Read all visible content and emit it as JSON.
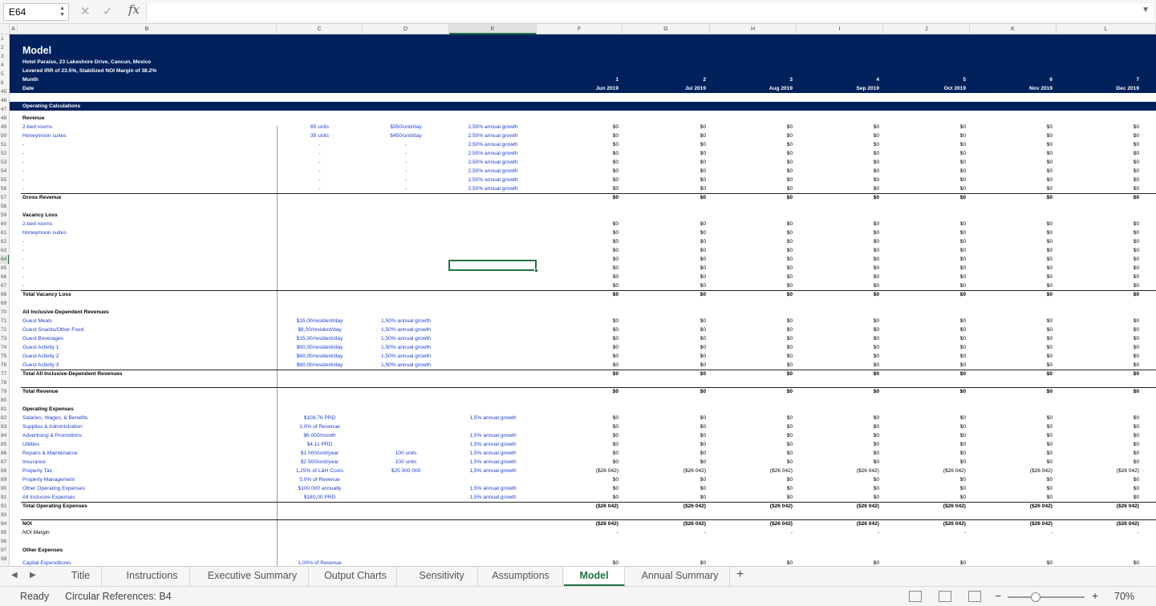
{
  "app": {
    "name_box": "E64",
    "fx": "fx",
    "formula": ""
  },
  "columns": [
    "A",
    "B",
    "C",
    "D",
    "E",
    "F",
    "G",
    "H",
    "I",
    "J",
    "K",
    "L"
  ],
  "header": {
    "title": "Model",
    "address": "Hotel Paraíso, 23 Lakeshore Drive, Cancun, Mexico",
    "summary": "Levered IRR of 23.5%, Stabilized NOI Margin of 38.2%",
    "row5": "Month",
    "row6": "Date",
    "months": [
      "1",
      "2",
      "3",
      "4",
      "5",
      "6",
      "7"
    ],
    "dates": [
      "Jun 2019",
      "Jul 2019",
      "Aug 2019",
      "Sep 2019",
      "Oct 2019",
      "Nov 2019",
      "Dec 2019"
    ]
  },
  "row_numbers": [
    "1",
    "2",
    "3",
    "4",
    "5",
    "6",
    "45",
    "46",
    "47",
    "48",
    "49",
    "50",
    "51",
    "52",
    "53",
    "54",
    "55",
    "56",
    "57",
    "58",
    "59",
    "60",
    "61",
    "62",
    "63",
    "64",
    "65",
    "66",
    "67",
    "68",
    "69",
    "70",
    "71",
    "72",
    "73",
    "74",
    "75",
    "76",
    "77",
    "78",
    "79",
    "80",
    "81",
    "82",
    "83",
    "84",
    "85",
    "86",
    "87",
    "88",
    "89",
    "90",
    "91",
    "92",
    "93",
    "94",
    "95",
    "96",
    "97",
    "98"
  ],
  "section": "Operating Calculations",
  "revenue": {
    "heading": "Revenue",
    "rows": [
      {
        "label": "2-bed rooms",
        "c": "65 units",
        "d": "$350/unit/day",
        "e": "2,50% annual growth"
      },
      {
        "label": "Honeymoon suites",
        "c": "35 units",
        "d": "$450/unit/day",
        "e": "2,50% annual growth"
      },
      {
        "label": "-",
        "c": "-",
        "d": "-",
        "e": "2,50% annual growth"
      },
      {
        "label": "-",
        "c": "-",
        "d": "-",
        "e": "2,50% annual growth"
      },
      {
        "label": "-",
        "c": "-",
        "d": "-",
        "e": "2,50% annual growth"
      },
      {
        "label": "-",
        "c": "-",
        "d": "-",
        "e": "2,50% annual growth"
      },
      {
        "label": "-",
        "c": "-",
        "d": "-",
        "e": "2,50% annual growth"
      },
      {
        "label": "-",
        "c": "-",
        "d": "-",
        "e": "2,50% annual growth"
      }
    ],
    "total": "Gross Revenue"
  },
  "vacancy": {
    "heading": "Vacancy Loss",
    "rows": [
      "2-bed rooms",
      "Honeymoon suites",
      "-",
      "-",
      "-",
      "-",
      "-",
      "-"
    ],
    "total": "Total Vacancy Loss"
  },
  "inclusive": {
    "heading": "All Inclusive-Dependent Revenues",
    "rows": [
      {
        "label": "Guest Meals",
        "c": "$15,00/resident/day",
        "d": "1,50% annual growth"
      },
      {
        "label": "Guest Snacks/Other Food",
        "c": "$6,00/resident/day",
        "d": "1,50% annual growth"
      },
      {
        "label": "Guest Beverages",
        "c": "$15,00/resident/day",
        "d": "1,50% annual growth"
      },
      {
        "label": "Guest Activity 1",
        "c": "$60,00/resident/day",
        "d": "1,50% annual growth"
      },
      {
        "label": "Guest Activity 2",
        "c": "$60,00/resident/day",
        "d": "1,50% annual growth"
      },
      {
        "label": "Guest Activity 3",
        "c": "$60,00/resident/day",
        "d": "1,50% annual growth"
      }
    ],
    "total": "Total All Inclusive-Dependent Revenues"
  },
  "total_revenue": "Total Revenue",
  "opex": {
    "heading": "Operating Expenses",
    "rows": [
      {
        "label": "Salaries, Wages, & Benefits",
        "c": "$108,76 PRD",
        "d": "",
        "e": "1,5% annual growth",
        "v": "$0"
      },
      {
        "label": "Supplies & Administration",
        "c": "2,0% of Revenue",
        "d": "",
        "e": "",
        "v": "$0"
      },
      {
        "label": "Advertising & Promotions",
        "c": "$6 000/month",
        "d": "",
        "e": "1,5% annual growth",
        "v": "$0"
      },
      {
        "label": "Utilities",
        "c": "$4,11 PRD",
        "d": "",
        "e": "1,5% annual growth",
        "v": "$0"
      },
      {
        "label": "Repairs & Maintenance",
        "c": "$1 000/unit/year",
        "d": "100 units",
        "e": "1,5% annual growth",
        "v": "$0"
      },
      {
        "label": "Insurance",
        "c": "$2 500/unit/year",
        "d": "100 units",
        "e": "1,5% annual growth",
        "v": "$0"
      },
      {
        "label": "Property Tax",
        "c": "1,25% of L&H Costs",
        "d": "$25 000 000",
        "e": "1,5% annual growth",
        "v": "($26 042)"
      },
      {
        "label": "Property Management",
        "c": "5,0% of Revenue",
        "d": "",
        "e": "",
        "v": "$0"
      },
      {
        "label": "Other Operating Expenses",
        "c": "$100 000 annually",
        "d": "",
        "e": "1,5% annual growth",
        "v": "$0"
      },
      {
        "label": "All Inclusive Expenses",
        "c": "$180,00 PRD",
        "d": "",
        "e": "1,5% annual growth",
        "v": "$0"
      }
    ],
    "total": "Total Operating Expenses",
    "total_value": "($26 042)"
  },
  "noi": {
    "label": "NOI",
    "value": "($26 042)",
    "margin_label": "NOI Margin",
    "margin_value": "-"
  },
  "other": {
    "heading": "Other Expenses",
    "cutoff_label": "Capital Expenditures",
    "cutoff_c": "1,00% of Revenue"
  },
  "zero": "$0",
  "tabs": [
    "Title",
    "Instructions",
    "Executive Summary",
    "Output Charts",
    "Sensitivity",
    "Assumptions",
    "Model",
    "Annual Summary"
  ],
  "add_tab": "+",
  "status": {
    "ready": "Ready",
    "circular": "Circular References: B4",
    "zoom": "70%",
    "minus": "−",
    "plus": "+"
  }
}
